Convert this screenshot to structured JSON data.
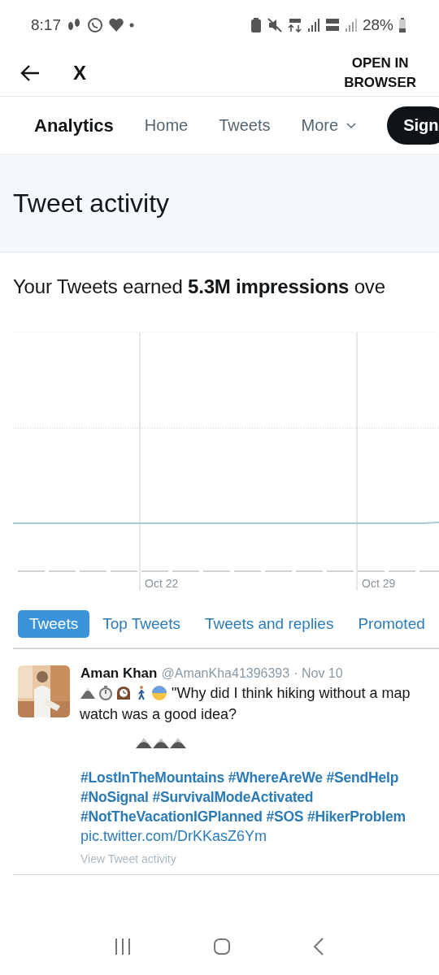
{
  "status_bar": {
    "time": "8:17",
    "battery": "28%"
  },
  "app_bar": {
    "title": "X",
    "action": "OPEN IN\nBROWSER"
  },
  "nav": {
    "brand": "Analytics",
    "items": [
      {
        "label": "Home",
        "kind": "link"
      },
      {
        "label": "Tweets",
        "kind": "link"
      },
      {
        "label": "More",
        "kind": "dropdown"
      }
    ],
    "button": "Sign"
  },
  "header": {
    "title": "Tweet activity"
  },
  "summary": "Your Tweets earned **5.3M impressions** ove",
  "chart": {
    "x_labels": [
      "Oct 22",
      "Oct 29"
    ]
  },
  "tabs": [
    {
      "label": "Tweets",
      "selected": true
    },
    {
      "label": "Top Tweets",
      "selected": false
    },
    {
      "label": "Tweets and replies",
      "selected": false
    },
    {
      "label": "Promoted",
      "selected": false
    }
  ],
  "tweets": [
    {
      "name": "Aman Khan",
      "handle": "@AmanKha41396393",
      "date": "· Nov 10",
      "text_lines": [
        "\"Why did I think hiking without a map",
        "watch was a good idea?"
      ],
      "hashtags": "#LostInTheMountains #WhereAreWe #SendHelp\n#NoSignal #SurvivalModeActivated\n#NotTheVacationIGPlanned #SOS #HikerProblem",
      "link": "pic.twitter.com/DrKKasZ6Ym",
      "activity": "View Tweet activity"
    }
  ]
}
